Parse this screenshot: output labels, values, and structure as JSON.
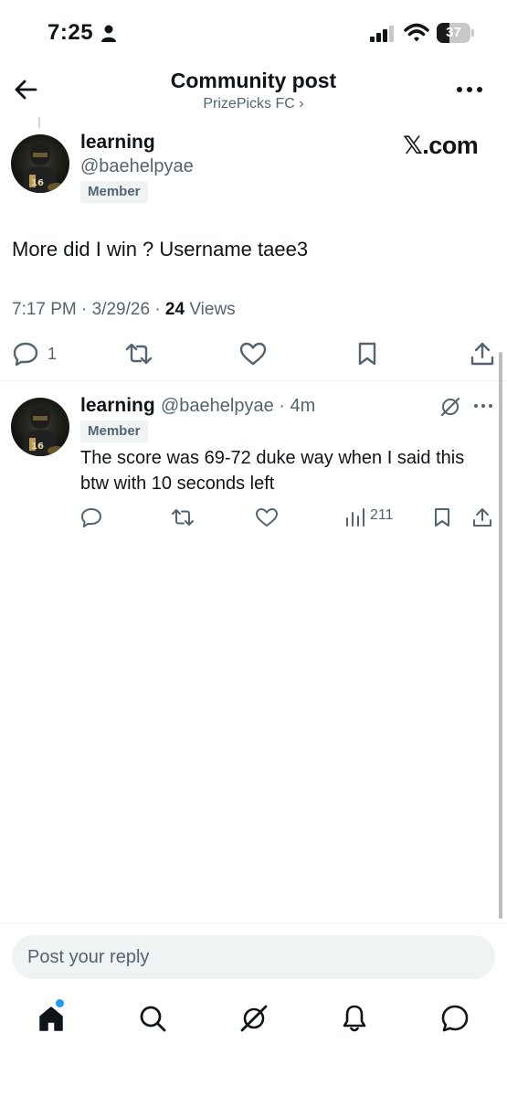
{
  "status_bar": {
    "time": "7:25",
    "battery_level": 37,
    "battery_label": "37"
  },
  "header": {
    "title": "Community post",
    "subtitle": "PrizePicks FC ›"
  },
  "post": {
    "author_name": "learning",
    "author_handle": "@baehelpyae",
    "badge": "Member",
    "source": "𝕏.com",
    "text": "More did I win ? Username taee3",
    "time_date": "7:17 PM · 3/29/26 · ",
    "views_count": "24",
    "views_label": " Views",
    "reply_count": "1"
  },
  "reply": {
    "author_name": "learning",
    "author_handle_time": "@baehelpyae · 4m",
    "badge": "Member",
    "text": "The score was 69-72 duke way when I said this btw with 10 seconds left",
    "views": "211"
  },
  "compose": {
    "placeholder": "Post your reply"
  },
  "tabbar": {
    "items": [
      "home-icon",
      "search-icon",
      "grok-icon",
      "notifications-icon",
      "messages-icon"
    ],
    "home_has_notification": true
  },
  "colors": {
    "text_primary": "#0f1419",
    "text_secondary": "#536471",
    "accent": "#1d9bf0",
    "badge_bg": "#eff3f4"
  }
}
